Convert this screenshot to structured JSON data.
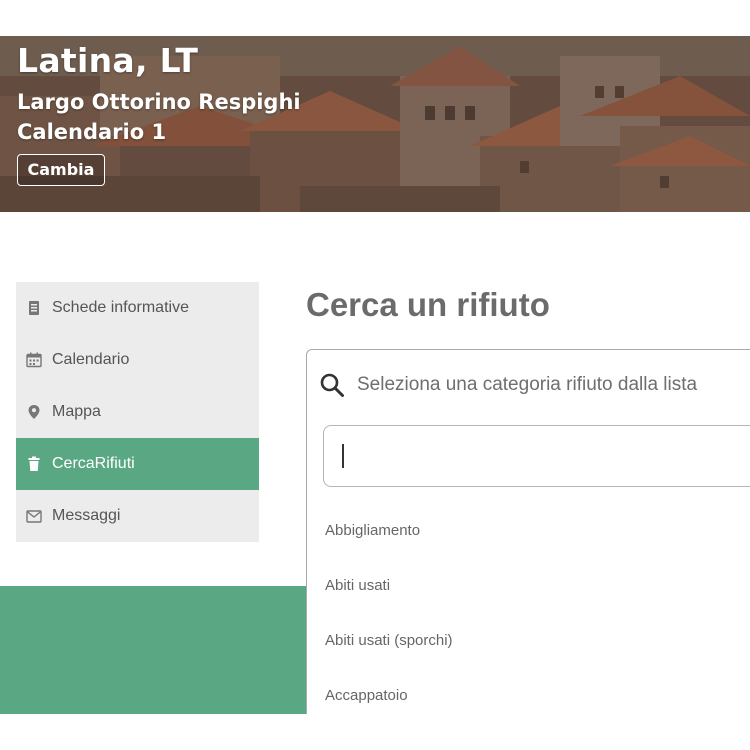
{
  "header": {
    "city": "Latina, LT",
    "address": "Largo Ottorino Respighi",
    "calendar": "Calendario 1",
    "change_label": "Cambia"
  },
  "sidebar": {
    "items": [
      {
        "label": "Schede informative",
        "icon": "document-icon"
      },
      {
        "label": "Calendario",
        "icon": "calendar-icon"
      },
      {
        "label": "Mappa",
        "icon": "map-pin-icon"
      },
      {
        "label": "CercaRifiuti",
        "icon": "trash-icon",
        "active": true
      },
      {
        "label": "Messaggi",
        "icon": "envelope-icon"
      }
    ]
  },
  "main": {
    "title": "Cerca un rifiuto",
    "select": {
      "placeholder": "Seleziona una categoria rifiuto dalla lista",
      "search_value": "",
      "options": [
        "Abbigliamento",
        "Abiti usati",
        "Abiti usati (sporchi)",
        "Accappatoio"
      ]
    }
  },
  "colors": {
    "accent": "#5aa883",
    "sidebar_bg": "#ececec",
    "title_text": "#6b6b6b"
  }
}
